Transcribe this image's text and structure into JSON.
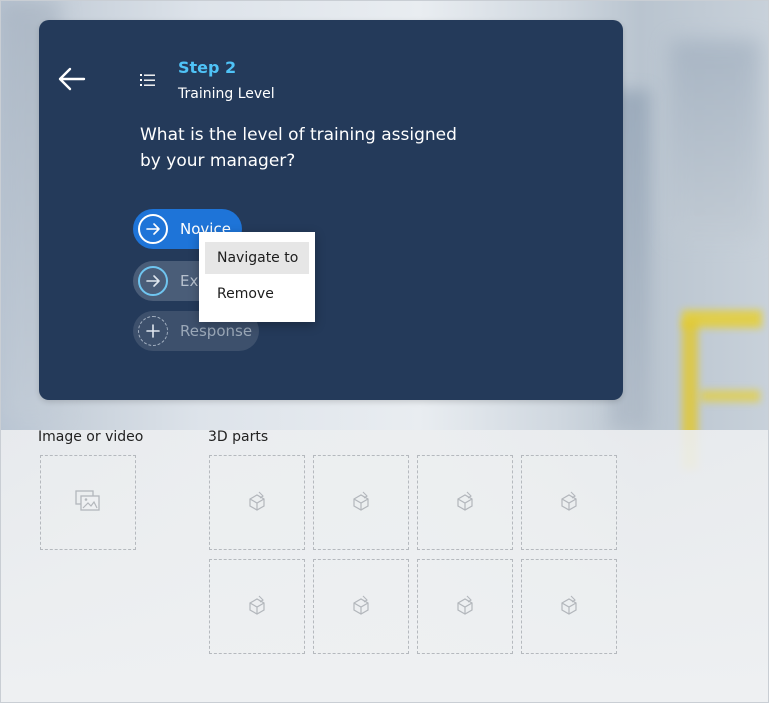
{
  "step": {
    "title": "Step 2",
    "subtitle": "Training Level",
    "question": "What is the level of training assigned by your manager?"
  },
  "responses": [
    {
      "label": "Novice",
      "icon": "arrow-right-icon"
    },
    {
      "label": "Exp",
      "icon": "arrow-right-icon"
    },
    {
      "label": "Response",
      "icon": "plus-icon"
    }
  ],
  "context_menu": {
    "items": [
      {
        "label": "Navigate to"
      },
      {
        "label": "Remove"
      }
    ]
  },
  "media": {
    "label": "Image or video",
    "icon": "image-icon"
  },
  "parts": {
    "label": "3D parts",
    "icon": "3d-part-icon",
    "slot_count": 8
  },
  "colors": {
    "panel": "#243a5a",
    "accent": "#4fc3f7",
    "selected_response": "#1e74d8"
  }
}
